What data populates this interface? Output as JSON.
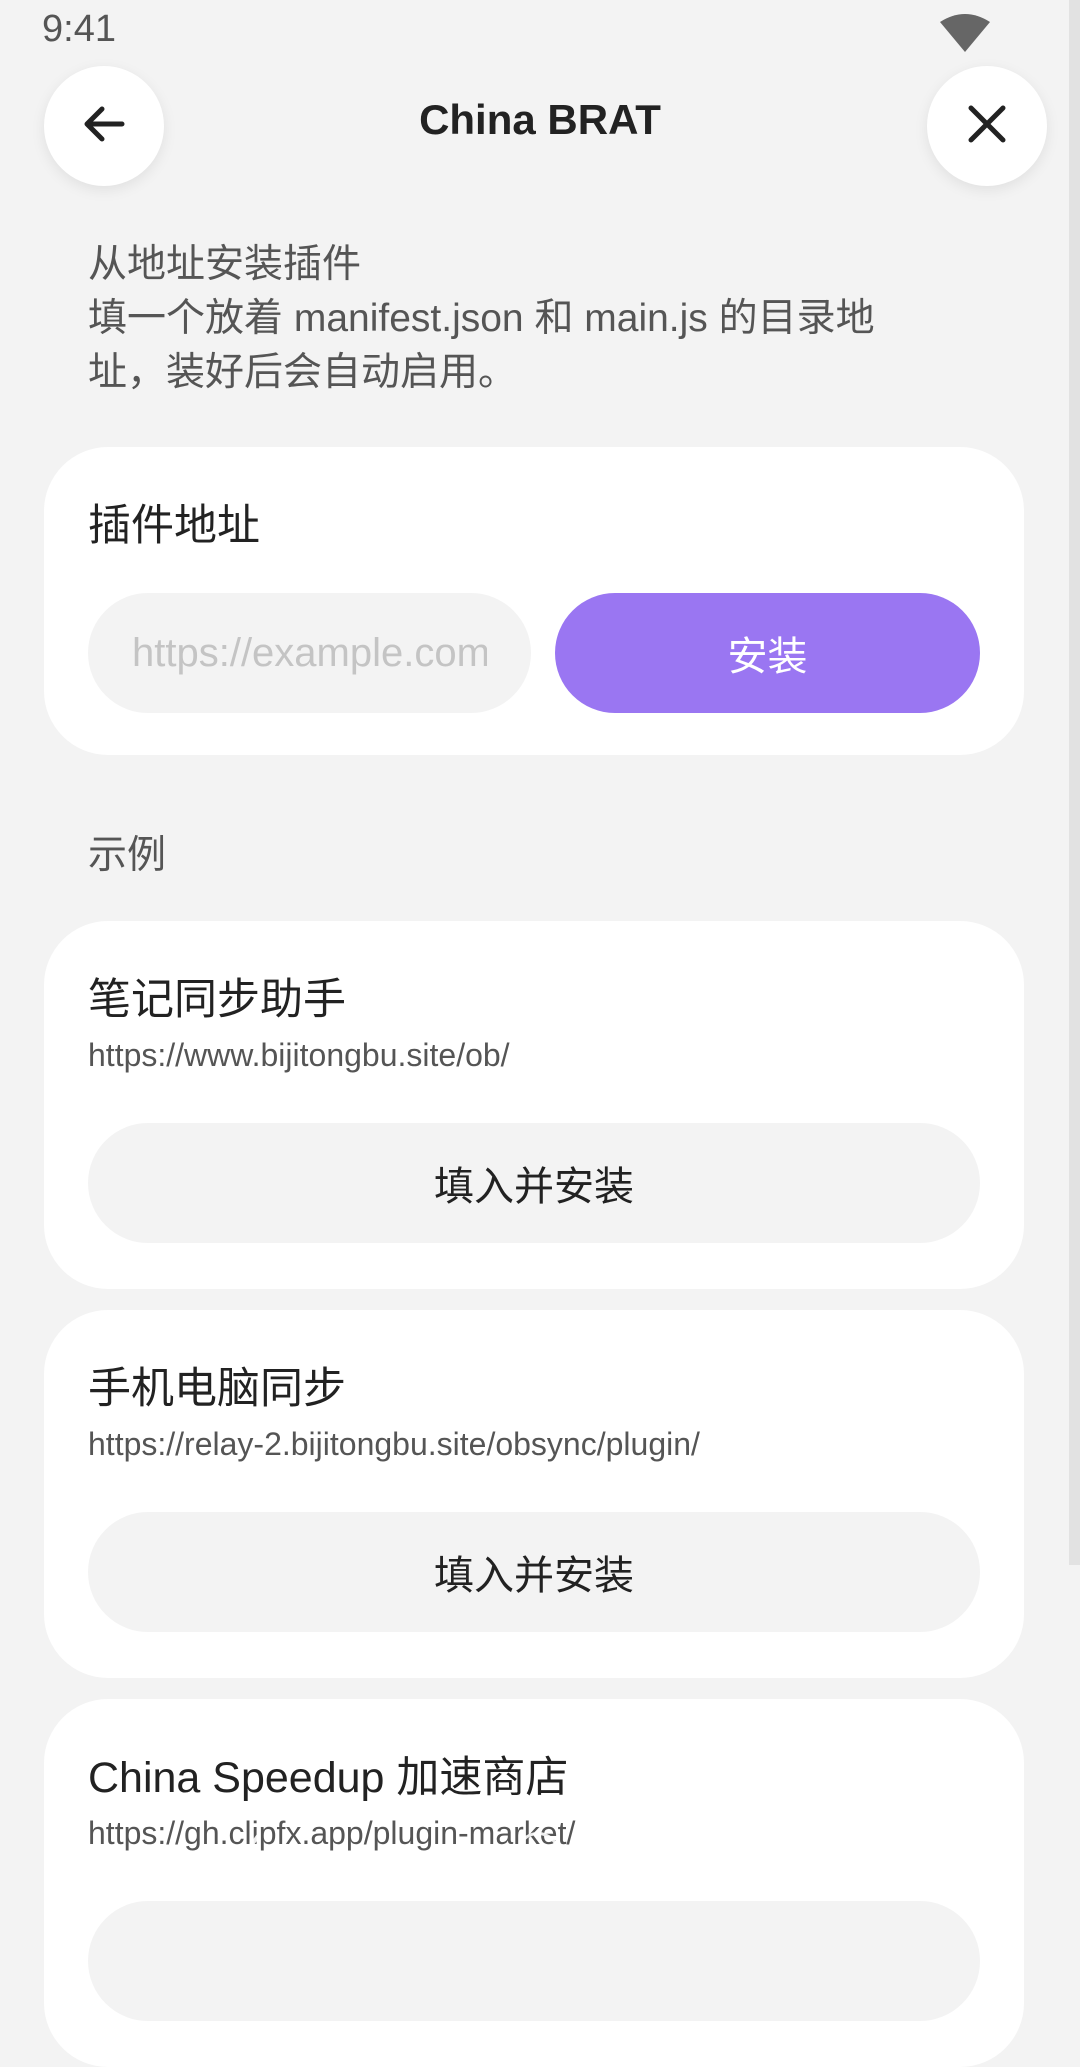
{
  "status_bar": {
    "time": "9:41",
    "wifi_icon": "wifi-icon"
  },
  "header": {
    "title": "China BRAT",
    "back_icon": "arrow-left-icon",
    "close_icon": "close-icon"
  },
  "description": {
    "line1": "从地址安装插件",
    "line2": "填一个放着 manifest.json 和 main.js 的目录地",
    "line3": "址，装好后会自动启用。"
  },
  "install_card": {
    "label": "插件地址",
    "input_placeholder": "https://example.com",
    "input_value": "",
    "install_label": "安装"
  },
  "examples": {
    "section_label": "示例",
    "items": [
      {
        "title": "笔记同步助手",
        "url": "https://www.bijitongbu.site/ob/",
        "button_label": "填入并安装"
      },
      {
        "title": "手机电脑同步",
        "url": "https://relay-2.bijitongbu.site/obsync/plugin/",
        "button_label": "填入并安装"
      },
      {
        "title": "China Speedup 加速商店",
        "url": "https://gh.clipfx.app/plugin-market/"
      }
    ]
  },
  "nav_bar": {
    "back_icon": "nav-back-icon",
    "home_icon": "nav-home-icon",
    "recents_icon": "nav-recents-icon"
  },
  "colors": {
    "background": "#f3f3f3",
    "card": "#ffffff",
    "accent": "#9a76f2",
    "text_primary": "#222222",
    "text_secondary": "#555555",
    "placeholder": "#c4c4c4"
  }
}
